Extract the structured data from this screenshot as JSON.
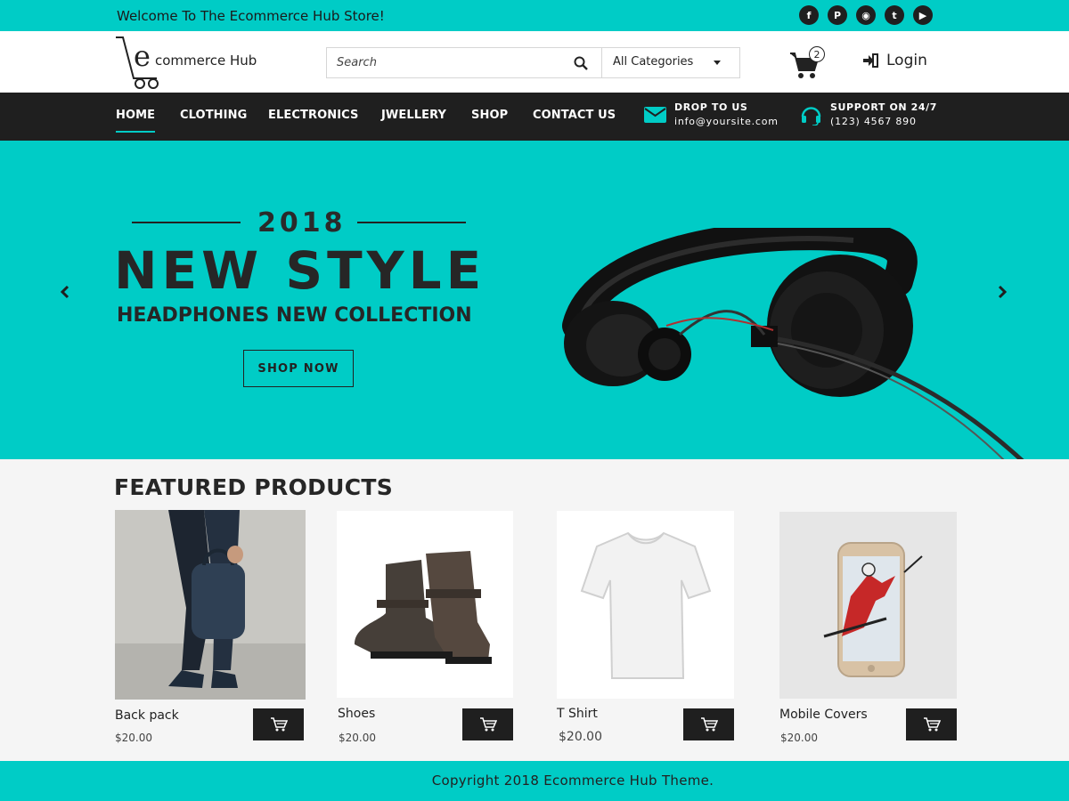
{
  "topbar": {
    "welcome": "Welcome To The Ecommerce Hub Store!",
    "socials": [
      {
        "icon": "facebook-icon",
        "glyph": "f"
      },
      {
        "icon": "pinterest-icon",
        "glyph": "P"
      },
      {
        "icon": "rss-icon",
        "glyph": "◉"
      },
      {
        "icon": "twitter-icon",
        "glyph": "t"
      },
      {
        "icon": "youtube-icon",
        "glyph": "▶"
      }
    ]
  },
  "header": {
    "logo_text": "commerce Hub",
    "logo_letter": "e",
    "search_placeholder": "Search",
    "category": "All Categories",
    "cart_count": "2",
    "login": "Login"
  },
  "nav": {
    "items": [
      "HOME",
      "CLOTHING",
      "ELECTRONICS",
      "JWELLERY",
      "SHOP",
      "CONTACT US"
    ],
    "active": "HOME",
    "mail_title": "DROP TO US",
    "mail_value": "info@yoursite.com",
    "support_title": "SUPPORT ON 24/7",
    "support_value": "(123) 4567 890"
  },
  "hero": {
    "year": "2018",
    "headline": "NEW STYLE",
    "subtitle": "HEADPHONES NEW COLLECTION",
    "cta": "SHOP NOW"
  },
  "featured": {
    "title": "FEATURED PRODUCTS",
    "products": [
      {
        "name": "Back pack",
        "price": "$20.00"
      },
      {
        "name": "Shoes",
        "price": "$20.00"
      },
      {
        "name": "T Shirt",
        "price": "$20.00"
      },
      {
        "name": "Mobile Covers",
        "price": "$20.00"
      }
    ]
  },
  "footer": {
    "copyright": "Copyright 2018 Ecommerce Hub Theme."
  },
  "colors": {
    "accent": "#00ccc6",
    "dark": "#1f1f1f"
  }
}
